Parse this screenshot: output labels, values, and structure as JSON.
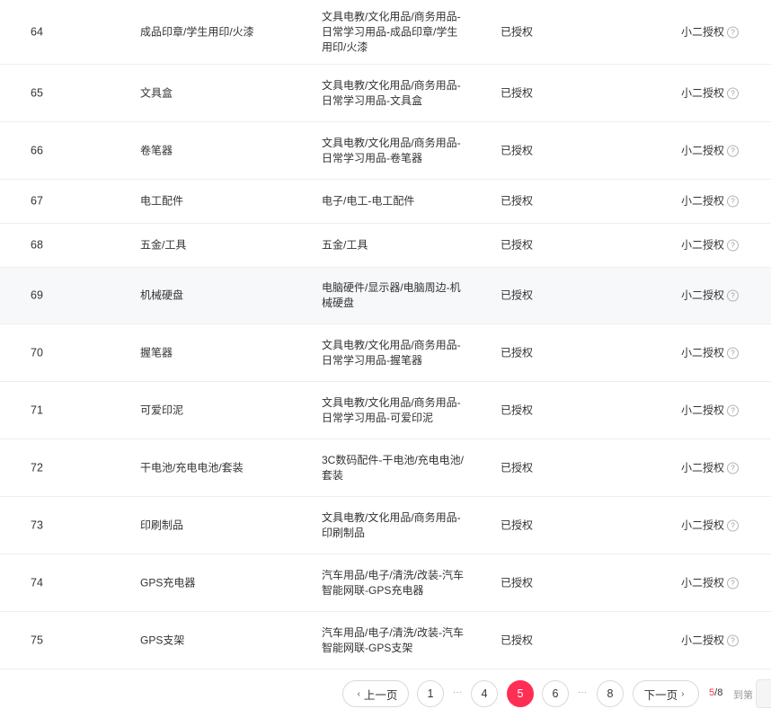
{
  "table": {
    "rows": [
      {
        "num": "64",
        "name": "成品印章/学生用印/火漆",
        "path": [
          "文具电教/文化用品/商务用品-",
          "日常学习用品-成品印章/学生",
          "用印/火漆"
        ],
        "status": "已授权",
        "auth": "小二授权"
      },
      {
        "num": "65",
        "name": "文具盒",
        "path": [
          "文具电教/文化用品/商务用品-",
          "日常学习用品-文具盒"
        ],
        "status": "已授权",
        "auth": "小二授权"
      },
      {
        "num": "66",
        "name": "卷笔器",
        "path": [
          "文具电教/文化用品/商务用品-",
          "日常学习用品-卷笔器"
        ],
        "status": "已授权",
        "auth": "小二授权"
      },
      {
        "num": "67",
        "name": "电工配件",
        "path": [
          "电子/电工-电工配件"
        ],
        "status": "已授权",
        "auth": "小二授权"
      },
      {
        "num": "68",
        "name": "五金/工具",
        "path": [
          "五金/工具"
        ],
        "status": "已授权",
        "auth": "小二授权"
      },
      {
        "num": "69",
        "name": "机械硬盘",
        "path": [
          "电脑硬件/显示器/电脑周边-机",
          "械硬盘"
        ],
        "status": "已授权",
        "auth": "小二授权"
      },
      {
        "num": "70",
        "name": "握笔器",
        "path": [
          "文具电教/文化用品/商务用品-",
          "日常学习用品-握笔器"
        ],
        "status": "已授权",
        "auth": "小二授权"
      },
      {
        "num": "71",
        "name": "可爱印泥",
        "path": [
          "文具电教/文化用品/商务用品-",
          "日常学习用品-可爱印泥"
        ],
        "status": "已授权",
        "auth": "小二授权"
      },
      {
        "num": "72",
        "name": "干电池/充电电池/套装",
        "path": [
          "3C数码配件-干电池/充电电池/",
          "套装"
        ],
        "status": "已授权",
        "auth": "小二授权"
      },
      {
        "num": "73",
        "name": "印刷制品",
        "path": [
          "文具电教/文化用品/商务用品-",
          "印刷制品"
        ],
        "status": "已授权",
        "auth": "小二授权"
      },
      {
        "num": "74",
        "name": "GPS充电器",
        "path": [
          "汽车用品/电子/清洗/改装-汽车",
          "智能网联-GPS充电器"
        ],
        "status": "已授权",
        "auth": "小二授权"
      },
      {
        "num": "75",
        "name": "GPS支架",
        "path": [
          "汽车用品/电子/清洗/改装-汽车",
          "智能网联-GPS支架"
        ],
        "status": "已授权",
        "auth": "小二授权"
      }
    ],
    "help_icon": "help-circle-icon"
  },
  "pagination": {
    "prev_label": "上一页",
    "next_label": "下一页",
    "pages": [
      "1",
      "4",
      "5",
      "6",
      "8"
    ],
    "ellipsis": "···",
    "current_page": "5",
    "total_pages": "8",
    "goto_label": "到第",
    "accent_color": "#ff2e54"
  }
}
